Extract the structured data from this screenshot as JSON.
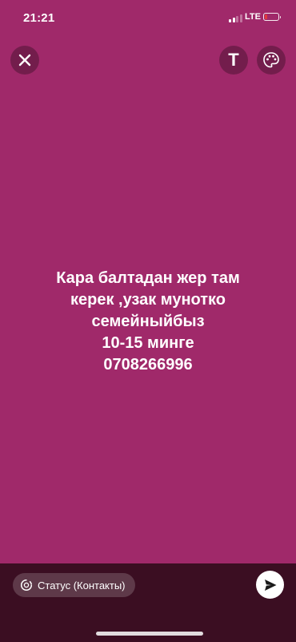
{
  "status_bar": {
    "time": "21:21",
    "network": "LTE"
  },
  "toolbar": {
    "close_icon": "close-icon",
    "text_tool_label": "T",
    "palette_icon": "palette-icon"
  },
  "message": {
    "lines": [
      "Кара балтадан жер там",
      "керек ,узак мунотко",
      "семейныйбыз",
      "10-15 минге",
      "0708266996"
    ],
    "background_color": "#a0296a"
  },
  "footer": {
    "audience_label": "Статус (Контакты)",
    "send_icon": "send-icon"
  }
}
